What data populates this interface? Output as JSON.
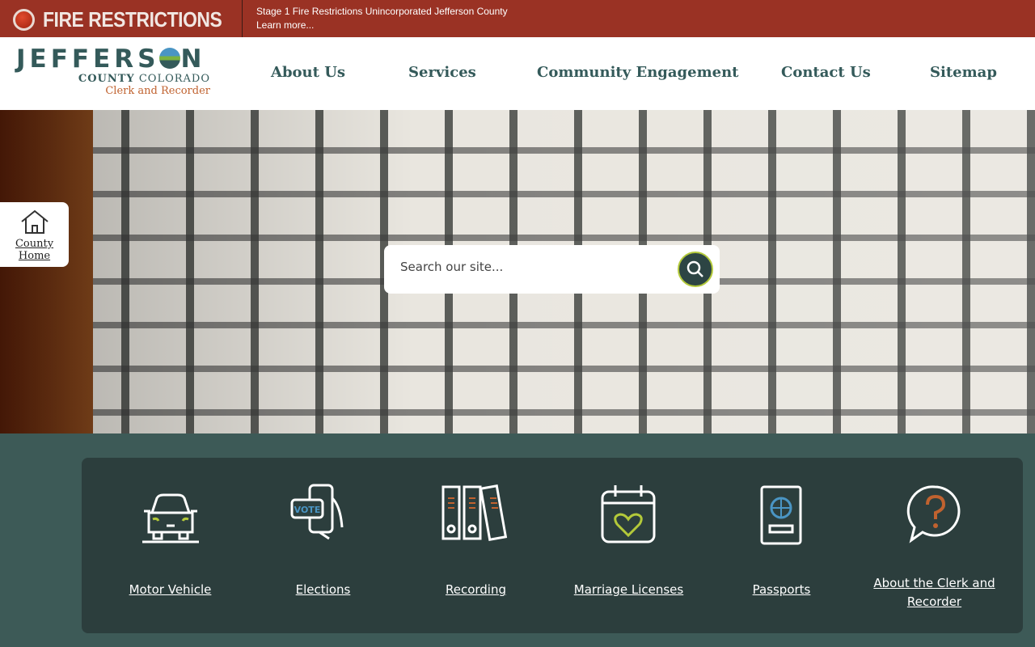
{
  "alert": {
    "title": "FIRE RESTRICTIONS",
    "message": "Stage 1 Fire Restrictions Unincorporated Jefferson County",
    "link": "Learn more..."
  },
  "logo": {
    "name_part1": "JEFFERS",
    "name_part2": "N",
    "sub": "COUNTY",
    "sub2": "COLORADO",
    "dept": "Clerk and Recorder"
  },
  "nav": [
    {
      "label": "About Us"
    },
    {
      "label": "Services"
    },
    {
      "label": "Community Engagement"
    },
    {
      "label": "Contact Us"
    },
    {
      "label": "Sitemap"
    }
  ],
  "home": {
    "line1": "County",
    "line2": "Home"
  },
  "search": {
    "placeholder": "Search our site..."
  },
  "tiles": [
    {
      "label": "Motor Vehicle",
      "icon": "car-icon"
    },
    {
      "label": "Elections",
      "icon": "vote-phone-icon",
      "icon_text": "VOTE"
    },
    {
      "label": "Recording",
      "icon": "binders-icon"
    },
    {
      "label": "Marriage Licenses",
      "icon": "calendar-heart-icon"
    },
    {
      "label": "Passports",
      "icon": "passport-icon"
    },
    {
      "label": "About the Clerk and Recorder",
      "icon": "question-bubble-icon"
    }
  ],
  "colors": {
    "alert": "#9a3224",
    "brand": "#345a5a",
    "accent_green": "#b3c93a",
    "accent_orange": "#c0622f",
    "panel": "#2c3e3d"
  }
}
